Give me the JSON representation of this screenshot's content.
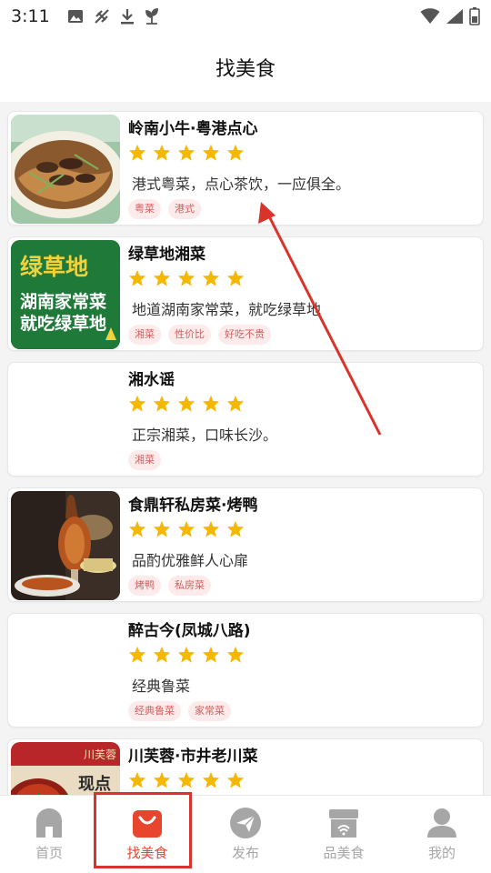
{
  "status": {
    "time": "3:11",
    "icons": [
      "image-icon",
      "no-sync-icon",
      "download-icon",
      "plant-icon",
      "wifi-icon",
      "signal-icon",
      "battery-icon"
    ]
  },
  "header": {
    "title": "找美食"
  },
  "restaurants": [
    {
      "name": "岭南小牛·粤港点心",
      "rating": 5,
      "desc": "港式粤菜，点心茶饮，一应俱全。",
      "tags": [
        "粤菜",
        "港式"
      ],
      "thumb": "beef-noodle"
    },
    {
      "name": "绿草地湘菜",
      "rating": 5,
      "desc": "地道湖南家常菜，就吃绿草地",
      "tags": [
        "湘菜",
        "性价比",
        "好吃不贵"
      ],
      "thumb": "green-logo",
      "thumb_text": {
        "brand": "绿草地",
        "line1": "湖南家常菜",
        "line2": "就吃绿草地"
      }
    },
    {
      "name": "湘水谣",
      "rating": 5,
      "desc": "正宗湘菜，口味长沙。",
      "tags": [
        "湘菜"
      ],
      "thumb": "none"
    },
    {
      "name": "食鼎轩私房菜·烤鸭",
      "rating": 5,
      "desc": "品酌优雅鲜人心扉",
      "tags": [
        "烤鸭",
        "私房菜"
      ],
      "thumb": "roast-duck"
    },
    {
      "name": "醉古今(凤城八路)",
      "rating": 5,
      "desc": "经典鲁菜",
      "tags": [
        "经典鲁菜",
        "家常菜"
      ],
      "thumb": "none"
    },
    {
      "name": "川芙蓉·市井老川菜",
      "rating": 5,
      "desc": "",
      "tags": [],
      "thumb": "sichuan",
      "thumb_text": {
        "brand": "川芙蓉",
        "sub": "现点"
      }
    }
  ],
  "tabbar": {
    "active": 1,
    "tabs": [
      {
        "label": "首页",
        "icon": "home-icon"
      },
      {
        "label": "找美食",
        "icon": "shopping-bag-icon"
      },
      {
        "label": "发布",
        "icon": "send-icon"
      },
      {
        "label": "品美食",
        "icon": "store-icon"
      },
      {
        "label": "我的",
        "icon": "user-icon"
      }
    ]
  },
  "colors": {
    "accent": "#e8452f",
    "star": "#f5b800",
    "tag_text": "#d06060",
    "tag_bg": "#fcebea",
    "annotation": "#d9342b"
  }
}
